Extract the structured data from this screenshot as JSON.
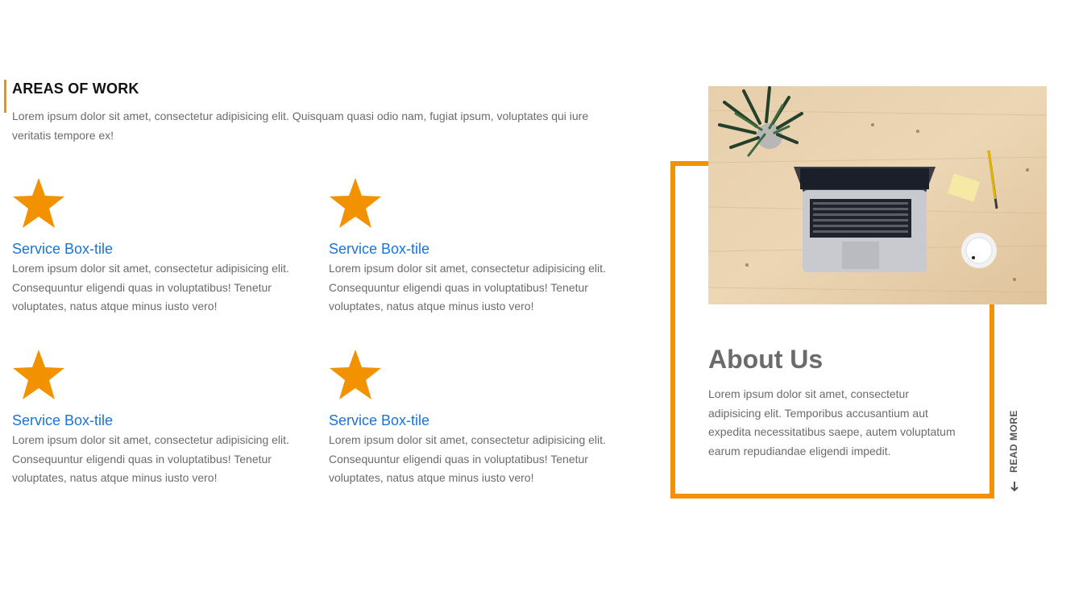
{
  "areas": {
    "title": "AREAS OF WORK",
    "description": "Lorem ipsum dolor sit amet, consectetur adipisicing elit. Quisquam quasi odio nam, fugiat ipsum, voluptates qui iure veritatis tempore ex!",
    "services": [
      {
        "icon": "star-icon",
        "title": "Service Box-tile",
        "text": "Lorem ipsum dolor sit amet, consectetur adipisicing elit. Consequuntur eligendi quas in voluptatibus! Tenetur voluptates, natus atque minus iusto vero!"
      },
      {
        "icon": "star-icon",
        "title": "Service Box-tile",
        "text": "Lorem ipsum dolor sit amet, consectetur adipisicing elit. Consequuntur eligendi quas in voluptatibus! Tenetur voluptates, natus atque minus iusto vero!"
      },
      {
        "icon": "star-icon",
        "title": "Service Box-tile",
        "text": "Lorem ipsum dolor sit amet, consectetur adipisicing elit. Consequuntur eligendi quas in voluptatibus! Tenetur voluptates, natus atque minus iusto vero!"
      },
      {
        "icon": "star-icon",
        "title": "Service Box-tile",
        "text": "Lorem ipsum dolor sit amet, consectetur adipisicing elit. Consequuntur eligendi quas in voluptatibus! Tenetur voluptates, natus atque minus iusto vero!"
      }
    ]
  },
  "about": {
    "title": "About Us",
    "description": "Lorem ipsum dolor sit amet, consectetur adipisicing elit. Temporibus accusantium aut expedita necessitatibus saepe, autem voluptatum earum repudiandae eligendi impedit.",
    "read_more": "READ MORE",
    "photo": "desk-with-laptop-photo"
  },
  "colors": {
    "accent": "#f39200",
    "link": "#1a73d9",
    "text": "#6b6b6b",
    "heading": "#111111"
  }
}
